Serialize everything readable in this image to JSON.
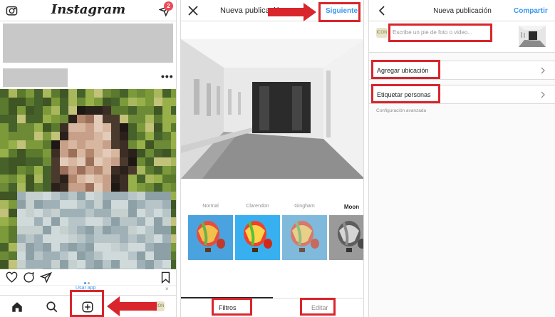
{
  "feed": {
    "logo": "Instagram",
    "dm_badge_count": "2",
    "use_app_text": "Usar app",
    "use_app_close": "×",
    "avatar_text": "ICON"
  },
  "new_post_filters": {
    "title": "Nueva publicación",
    "next_label": "Siguiente",
    "filters": [
      {
        "name": "Normal",
        "active": false
      },
      {
        "name": "Clarendon",
        "active": false
      },
      {
        "name": "Gingham",
        "active": false
      },
      {
        "name": "Moon",
        "active": true
      }
    ],
    "tabs": {
      "filters": "Filtros",
      "edit": "Editar"
    }
  },
  "new_post_details": {
    "title": "Nueva publicación",
    "share_label": "Compartir",
    "caption_placeholder": "Escribe un pie de foto o video...",
    "avatar_text": "ICON",
    "add_location": "Agregar ubicación",
    "tag_people": "Etiquetar personas",
    "advanced_settings": "Configuración avanzada"
  },
  "colors": {
    "accent_blue": "#3897f0",
    "annotation_red": "#d8262c",
    "badge_red": "#ed4956",
    "border": "#dbdbdb"
  },
  "icons": [
    "camera-icon",
    "direct-message-icon",
    "more-icon",
    "heart-icon",
    "comment-icon",
    "share-icon",
    "bookmark-icon",
    "home-icon",
    "search-icon",
    "new-post-icon",
    "close-icon",
    "back-icon",
    "chevron-right-icon",
    "arrow-icon"
  ]
}
